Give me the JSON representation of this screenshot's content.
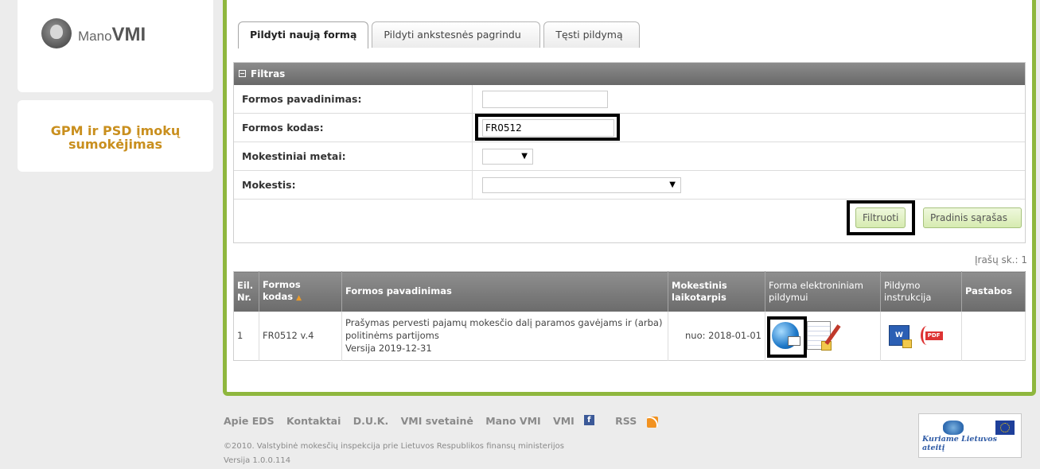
{
  "sidebar": {
    "logo_prefix": "Mano",
    "logo_brand": "VMI",
    "menu_link": "GPM ir PSD įmokų sumokėjimas"
  },
  "tabs": [
    {
      "label": "Pildyti naują formą",
      "active": true
    },
    {
      "label": "Pildyti ankstesnės pagrindu",
      "active": false
    },
    {
      "label": "Tęsti pildymą",
      "active": false
    }
  ],
  "filter": {
    "title": "Filtras",
    "fields": [
      {
        "label": "Formos pavadinimas:",
        "value": "",
        "type": "text"
      },
      {
        "label": "Formos kodas:",
        "value": "FR0512",
        "type": "text"
      },
      {
        "label": "Mokestiniai metai:",
        "value": "",
        "type": "select"
      },
      {
        "label": "Mokestis:",
        "value": "",
        "type": "select"
      }
    ],
    "filter_button": "Filtruoti",
    "reset_button": "Pradinis sąrašas"
  },
  "records_count": "Įrašų sk.: 1",
  "table": {
    "headers": [
      "Eil. Nr.",
      "Formos kodas",
      "Formos pavadinimas",
      "Mokestinis laikotarpis",
      "Forma elektroniniam pildymui",
      "Pildymo instrukcija",
      "Pastabos"
    ],
    "rows": [
      {
        "nr": "1",
        "code": "FR0512 v.4",
        "name": "Prašymas pervesti pajamų mokesčio dalį paramos gavėjams ir (arba) politinėms partijoms",
        "version": "Versija 2019-12-31",
        "period": "nuo: 2018-01-01",
        "notes": ""
      }
    ]
  },
  "footer": {
    "links": [
      "Apie EDS",
      "Kontaktai",
      "D.U.K.",
      "VMI svetainė",
      "Mano VMI",
      "VMI",
      "RSS"
    ],
    "copyright": "©2010. Valstybinė mokesčių inspekcija prie Lietuvos Respublikos finansų ministerijos",
    "version": "Versija 1.0.0.114",
    "eu_slogan": "Kuriame Lietuvos ateitį"
  },
  "colors": {
    "accent": "#8fb73e",
    "link": "#c98f1e",
    "header": "#777777"
  }
}
